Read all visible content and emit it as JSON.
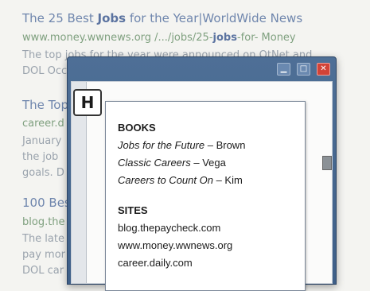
{
  "background_results": [
    {
      "title_parts": [
        "The 25 Best ",
        "Jobs",
        " for the Year|WorldWide News"
      ],
      "url_parts": [
        "www.money.wwnews.org /.../jobs/25-",
        "jobs",
        "-for- Money"
      ],
      "snippet_lines": [
        "The top jobs for the year were announced on OtNet and",
        "DOL Occ"
      ]
    },
    {
      "title": "The Top",
      "url": "career.d",
      "snippet_lines": [
        "January",
        "the job",
        "goals. D"
      ]
    },
    {
      "title": "100 Bes",
      "url": "blog.the",
      "snippet_lines": [
        "The late",
        "pay mor",
        "DOL car"
      ]
    }
  ],
  "window": {
    "buttons": {
      "minimize": "▁",
      "maximize": "□",
      "close": "✕"
    }
  },
  "badge": "H",
  "books": {
    "heading": "BOOKS",
    "items": [
      {
        "title": "Jobs for the Future",
        "author": " – Brown"
      },
      {
        "title": "Classic Careers",
        "author": " – Vega"
      },
      {
        "title": "Careers to Count On",
        "author": " – Kim"
      }
    ]
  },
  "sites": {
    "heading": "SITES",
    "items": [
      "blog.thepaycheck.com",
      "www.money.wwnews.org",
      "career.daily.com"
    ]
  }
}
